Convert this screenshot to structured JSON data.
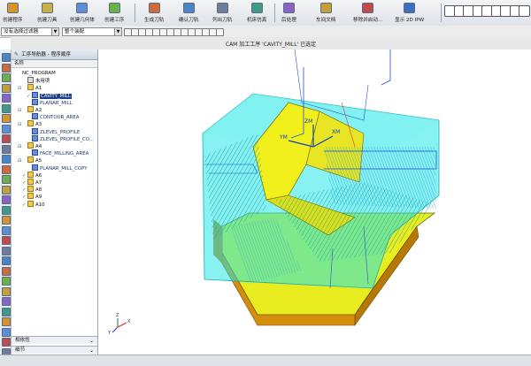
{
  "ribbon": {
    "buttons": [
      {
        "label": "创建程序",
        "icon": "create-program-icon",
        "color": "#d9932b"
      },
      {
        "label": "创建刀具",
        "icon": "create-tool-icon",
        "color": "#c8b04a"
      },
      {
        "label": "创建几何体",
        "icon": "create-geometry-icon",
        "color": "#5f8ed9"
      },
      {
        "label": "创建工序",
        "icon": "create-operation-icon",
        "color": "#6db04a"
      },
      {
        "label": "生成刀轨",
        "icon": "generate-toolpath-icon",
        "color": "#d06a3a"
      },
      {
        "label": "确认刀轨",
        "icon": "verify-toolpath-icon",
        "color": "#4a86c5"
      },
      {
        "label": "列出刀轨",
        "icon": "list-toolpath-icon",
        "color": "#6d7d9a"
      },
      {
        "label": "机床仿真",
        "icon": "machine-simulation-icon",
        "color": "#3f9b85"
      },
      {
        "label": "后处理",
        "icon": "postprocess-icon",
        "color": "#8a62c8"
      },
      {
        "label": "车间文档",
        "icon": "shop-doc-icon",
        "color": "#c5a03a"
      },
      {
        "label": "移除并启动...",
        "icon": "output-icon",
        "color": "#c24a4a"
      },
      {
        "label": "显示 2D IPW",
        "icon": "display-ipw-icon",
        "color": "#3f70c0"
      }
    ],
    "right_icons": [
      "check-icon",
      "check-icon",
      "calculator-icon",
      "tool-icon",
      "path-icon",
      "filter-icon",
      "list-icon",
      "grid-icon",
      "grid-icon"
    ]
  },
  "toolbar2": {
    "filter_select": "没有选择过滤器",
    "assembly_select": "整个装配"
  },
  "title": "CAM 加工工序 'CAVITY_MILL' 已选定",
  "navigator": {
    "header": "工序导航器 - 程序顺序",
    "column": "名称",
    "items": [
      {
        "label": "NC_PROGRAM",
        "indent": 0,
        "exp": "",
        "chk": "",
        "icon": "none"
      },
      {
        "label": "未用项",
        "indent": 1,
        "exp": "",
        "chk": "",
        "icon": "misc"
      },
      {
        "label": "A1",
        "indent": 1,
        "exp": "⊟",
        "chk": "",
        "icon": "folder"
      },
      {
        "label": "CAVITY_MILL",
        "indent": 2,
        "exp": "",
        "chk": "✓",
        "icon": "op",
        "selected": true
      },
      {
        "label": "PLANAR_MILL",
        "indent": 2,
        "exp": "",
        "chk": "",
        "icon": "op"
      },
      {
        "label": "A2",
        "indent": 1,
        "exp": "⊟",
        "chk": "",
        "icon": "folder"
      },
      {
        "label": "CONTOUR_AREA",
        "indent": 2,
        "exp": "",
        "chk": "",
        "icon": "op"
      },
      {
        "label": "A3",
        "indent": 1,
        "exp": "⊟",
        "chk": "",
        "icon": "folder"
      },
      {
        "label": "ZLEVEL_PROFILE",
        "indent": 2,
        "exp": "",
        "chk": "",
        "icon": "op"
      },
      {
        "label": "ZLEVEL_PROFILE_CO...",
        "indent": 2,
        "exp": "",
        "chk": "",
        "icon": "op"
      },
      {
        "label": "A4",
        "indent": 1,
        "exp": "⊟",
        "chk": "",
        "icon": "folder"
      },
      {
        "label": "FACE_MILLING_AREA",
        "indent": 2,
        "exp": "",
        "chk": "",
        "icon": "op"
      },
      {
        "label": "A5",
        "indent": 1,
        "exp": "⊟",
        "chk": "",
        "icon": "folder"
      },
      {
        "label": "PLANAR_MILL_COPY",
        "indent": 2,
        "exp": "",
        "chk": "",
        "icon": "op"
      },
      {
        "label": "A6",
        "indent": 1,
        "exp": "",
        "chk": "✓",
        "icon": "folder"
      },
      {
        "label": "A7",
        "indent": 1,
        "exp": "",
        "chk": "✓",
        "icon": "folder"
      },
      {
        "label": "A8",
        "indent": 1,
        "exp": "",
        "chk": "✓",
        "icon": "folder"
      },
      {
        "label": "A9",
        "indent": 1,
        "exp": "",
        "chk": "✓",
        "icon": "folder"
      },
      {
        "label": "A10",
        "indent": 1,
        "exp": "",
        "chk": "✓",
        "icon": "folder"
      }
    ],
    "bottom_panels": [
      {
        "label": "相依性"
      },
      {
        "label": "细节"
      }
    ]
  },
  "viewport": {
    "axis_labels": {
      "zm": "ZM",
      "xm": "XM",
      "ym": "YM"
    },
    "triad_labels": {
      "z": "Z",
      "x": "X",
      "y": "Y"
    }
  }
}
